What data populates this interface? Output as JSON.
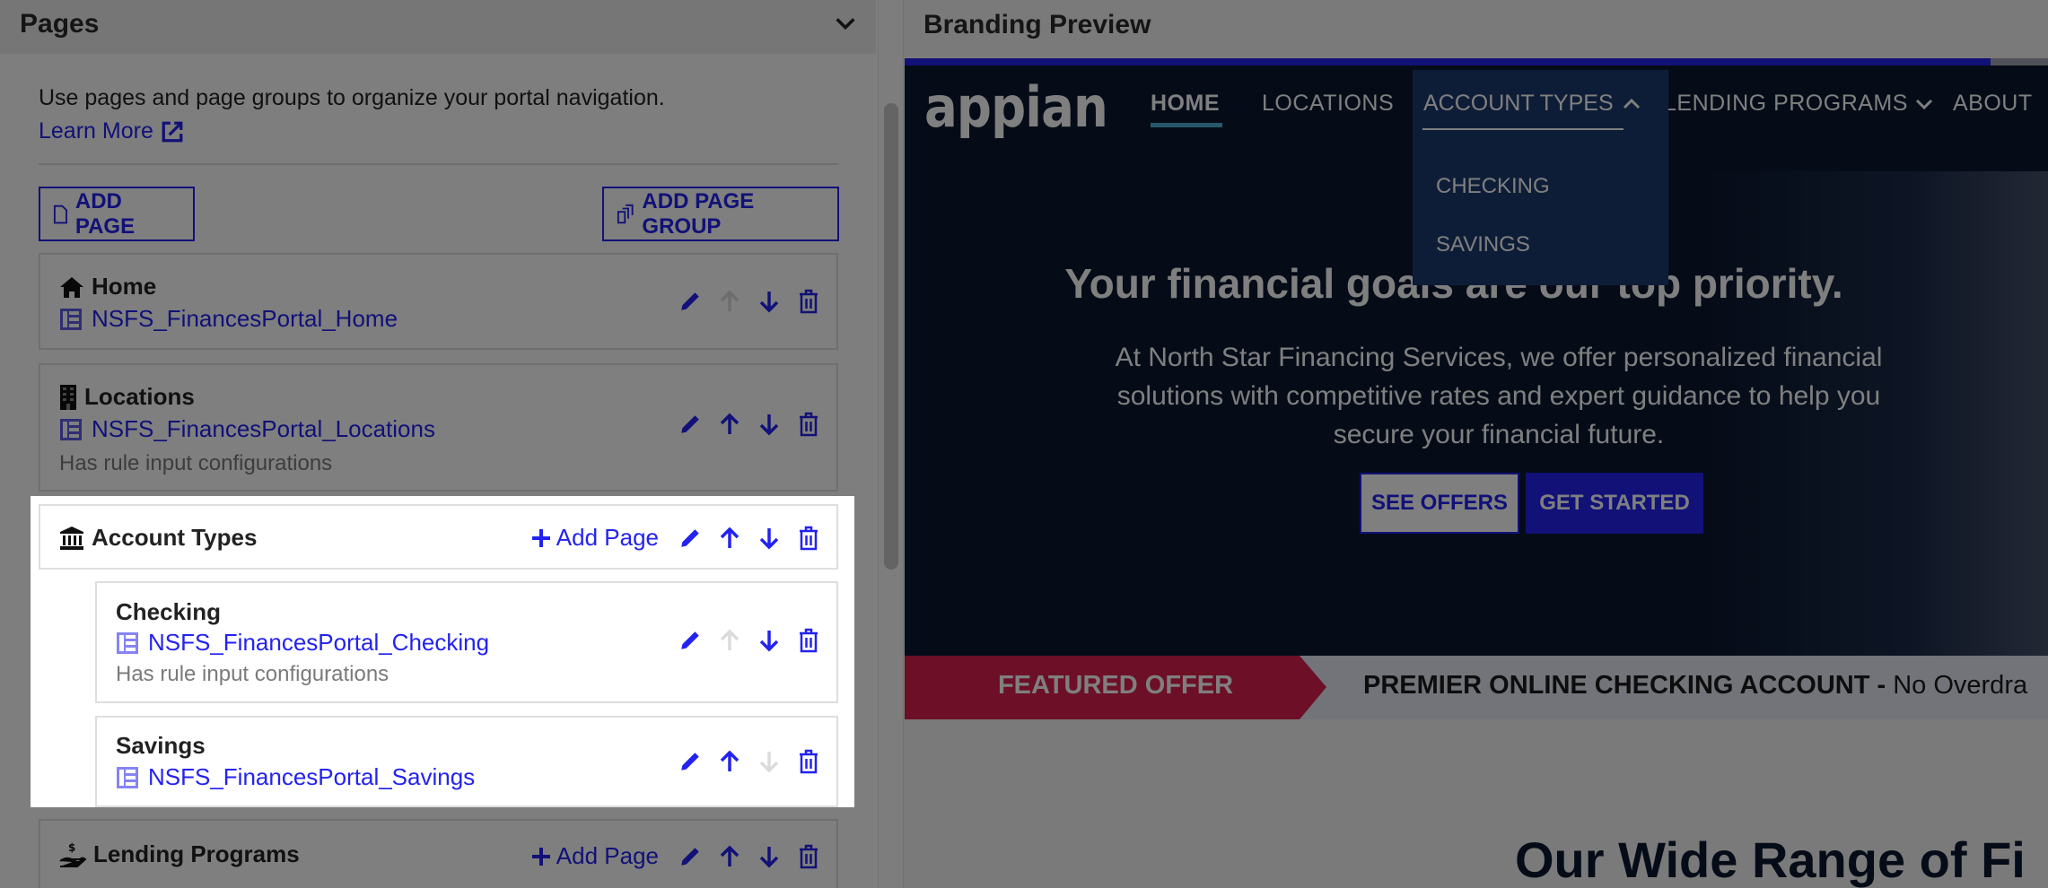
{
  "pages_panel": {
    "title": "Pages",
    "description": "Use pages and page groups to organize your portal navigation.",
    "learn_more": "Learn More",
    "add_page_button": "ADD PAGE",
    "add_page_group_button": "ADD PAGE GROUP",
    "note_text": "Has rule input configurations",
    "add_page_link": "Add Page",
    "items": [
      {
        "title": "Home",
        "icon": "home-icon",
        "interface": "NSFS_FinancesPortal_Home",
        "has_note": false,
        "up_enabled": false,
        "down_enabled": true
      },
      {
        "title": "Locations",
        "icon": "building-icon",
        "interface": "NSFS_FinancesPortal_Locations",
        "has_note": true,
        "up_enabled": true,
        "down_enabled": true
      }
    ],
    "groups": [
      {
        "title": "Account Types",
        "icon": "bank-icon",
        "highlighted": true,
        "children": [
          {
            "title": "Checking",
            "interface": "NSFS_FinancesPortal_Checking",
            "has_note": true,
            "up_enabled": false,
            "down_enabled": true
          },
          {
            "title": "Savings",
            "interface": "NSFS_FinancesPortal_Savings",
            "has_note": false,
            "up_enabled": true,
            "down_enabled": false
          }
        ]
      },
      {
        "title": "Lending Programs",
        "icon": "hand-money-icon",
        "highlighted": false,
        "children": []
      }
    ]
  },
  "preview": {
    "title": "Branding Preview",
    "logo": "appian",
    "progress_percent": 95,
    "nav": {
      "home": "HOME",
      "locations": "LOCATIONS",
      "account_types": "ACCOUNT TYPES",
      "lending_programs": "LENDING PROGRAMS",
      "about": "ABOUT",
      "active": "HOME"
    },
    "dropdown_items": [
      "CHECKING",
      "SAVINGS"
    ],
    "hero": {
      "title": "Your financial goals are our top priority.",
      "text": "At North Star Financing Services, we offer personalized financial solutions with competitive rates and expert guidance to help you secure your financial future.",
      "see_offers": "SEE OFFERS",
      "get_started": "GET STARTED"
    },
    "featured": {
      "tag": "FEATURED OFFER",
      "headline": "PREMIER ONLINE CHECKING ACCOUNT -",
      "detail": " No Overdra"
    },
    "section_heading": "Our Wide Range of Fi"
  },
  "colors": {
    "accent": "#2322f0",
    "nav_bg": "#0b1830",
    "dropdown_bg": "#1d3a6e",
    "featured_tag": "#d81f4f",
    "overlay": "rgba(0,0,0,0.5)"
  }
}
